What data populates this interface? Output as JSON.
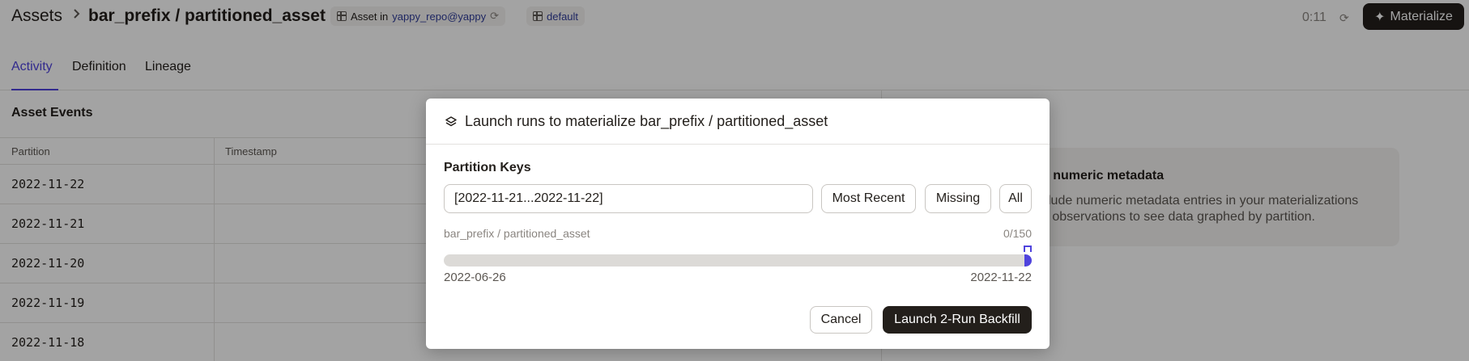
{
  "header": {
    "breadcrumb_root": "Assets",
    "asset_path": "bar_prefix / partitioned_asset",
    "repo_prefix": "Asset in",
    "repo_link": "yappy_repo@yappy",
    "group": "default",
    "timer": "0:11",
    "materialize_label": "Materialize"
  },
  "tabs": [
    {
      "label": "Activity",
      "active": true
    },
    {
      "label": "Definition",
      "active": false
    },
    {
      "label": "Lineage",
      "active": false
    }
  ],
  "events": {
    "title": "Asset Events",
    "columns": [
      "Partition",
      "Timestamp"
    ],
    "rows": [
      "2022-11-22",
      "2022-11-21",
      "2022-11-20",
      "2022-11-19",
      "2022-11-18"
    ]
  },
  "empty_state": {
    "title": "o numeric metadata",
    "body": "clude numeric metadata entries in your materializations\nd observations to see data graphed by partition."
  },
  "dialog": {
    "title": "Launch runs to materialize bar_prefix / partitioned_asset",
    "partition_keys_label": "Partition Keys",
    "partition_input_value": "[2022-11-21...2022-11-22]",
    "buttons": {
      "most_recent": "Most Recent",
      "missing": "Missing",
      "all": "All"
    },
    "asset_name": "bar_prefix / partitioned_asset",
    "materialized_count": "0/150",
    "selection_fraction": 0.013,
    "range_start": "2022-06-26",
    "range_end": "2022-11-22",
    "cancel_label": "Cancel",
    "launch_label": "Launch 2-Run Backfill"
  },
  "colors": {
    "accent": "#4f43dd",
    "primary_button": "#231f1b",
    "link": "#2f3c99"
  }
}
